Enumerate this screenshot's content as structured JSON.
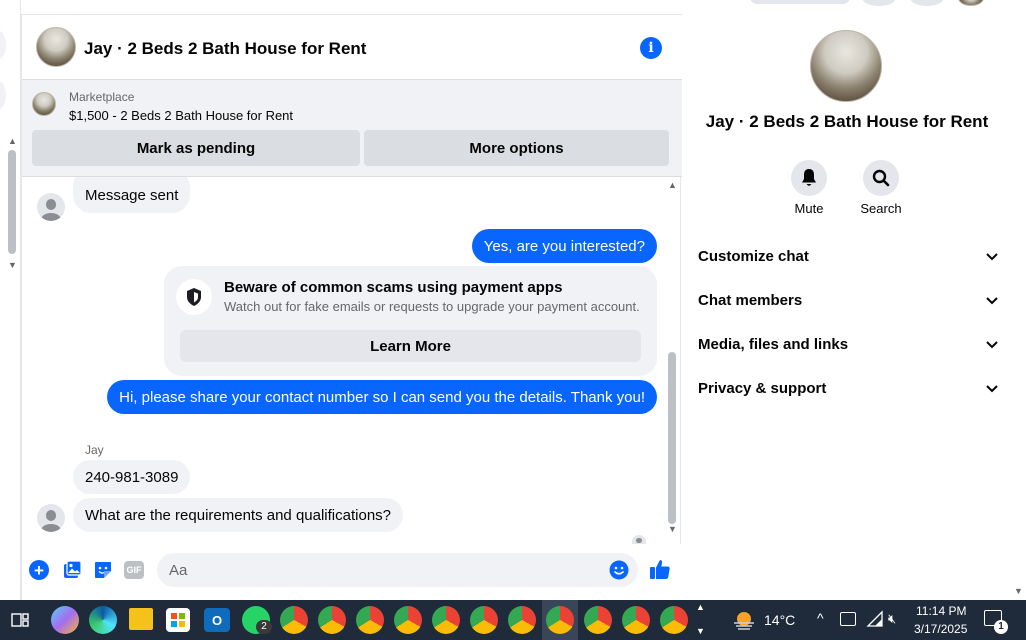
{
  "header": {
    "title": "Jay · 2 Beds 2 Bath House for Rent"
  },
  "marketplace": {
    "label": "Marketplace",
    "listing": "$1,500 - 2 Beds 2 Bath House for Rent",
    "mark_pending": "Mark as pending",
    "more_options": "More options"
  },
  "messages": {
    "m1": "Message sent",
    "m2": "Yes, are you interested?",
    "scam_title": "Beware of common scams using payment apps",
    "scam_body": "Watch out for fake emails or requests to upgrade your payment account.",
    "learn_more": "Learn More",
    "m3": "Hi, please share your contact number so I can send you the details. Thank you!",
    "sender": "Jay",
    "m4": "240-981-3089",
    "m5": "What are the requirements and qualifications?"
  },
  "composer": {
    "placeholder": "Aa",
    "gif": "GIF"
  },
  "details": {
    "title": "Jay · 2 Beds 2 Bath House for Rent",
    "mute": "Mute",
    "search": "Search",
    "sections": [
      "Customize chat",
      "Chat members",
      "Media, files and links",
      "Privacy & support"
    ]
  },
  "taskbar": {
    "whatsapp_badge": "2",
    "temperature": "14°C",
    "time": "11:14 PM",
    "date": "3/17/2025",
    "notifications": "1"
  },
  "colors": {
    "accent": "#0866ff",
    "bubble_in": "#f0f2f5",
    "taskbar": "#1f2b3b"
  },
  "icons": [
    "info-icon",
    "mute-bell-icon",
    "search-icon",
    "chevron-down-icon",
    "plus-icon",
    "photo-icon",
    "sticker-icon",
    "gif-icon",
    "emoji-icon",
    "like-thumb-icon",
    "shield-icon"
  ]
}
